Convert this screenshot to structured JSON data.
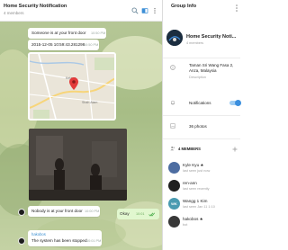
{
  "chat": {
    "title": "Home Security Notification",
    "subtitle": "4 members",
    "messages": [
      {
        "text": "Someone is at your front door",
        "time": "10:50 PM"
      },
      {
        "text": "2015-12-05 10:59:43.281298",
        "time": "10:50 PM"
      },
      {
        "text": "Nobody is at your front door",
        "time": "10:00 PM"
      },
      {
        "sent_text": "Okay",
        "sent_time": "10:01"
      },
      {
        "sender": "hakobos",
        "text": "The system has been stopped",
        "time": "10:01 PM"
      }
    ],
    "map_labels": [
      "Kelang",
      "Shah Alam"
    ]
  },
  "info": {
    "title": "Group Info",
    "group_name": "Home Security Noti...",
    "group_members": "4 members",
    "address": "Taman Sri Wang Fasa 2, Anza, Malaysia",
    "description_label": "Description",
    "notifications_label": "Notifications",
    "photos_label": "36 photos",
    "members_header": "4 MEMBERS",
    "members": [
      {
        "name": "Kyle Kyu ★",
        "status": "last seen just now",
        "color": "#4d6da1"
      },
      {
        "name": "ren-ann",
        "status": "last seen recently",
        "color": "#1f1f1f"
      },
      {
        "name": "Wangg 1 Kim",
        "status": "last seen Jan 11 1:10",
        "color": "#4a9bb1"
      },
      {
        "name": "hakobos ★",
        "status": "bot",
        "color": "#383838"
      }
    ]
  }
}
